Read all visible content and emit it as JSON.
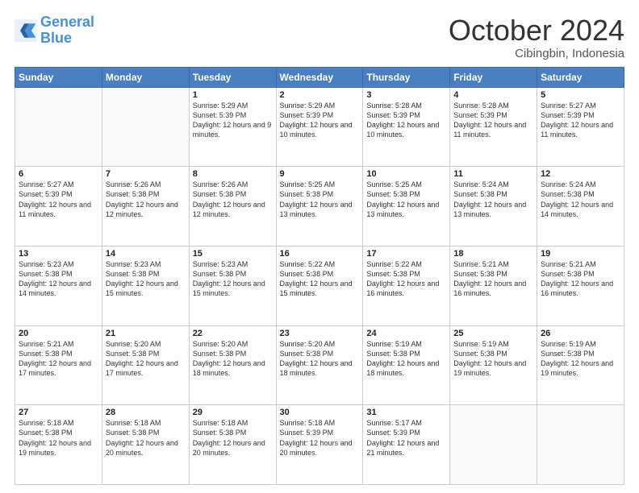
{
  "header": {
    "logo_line1": "General",
    "logo_line2": "Blue",
    "month": "October 2024",
    "location": "Cibingbin, Indonesia"
  },
  "weekdays": [
    "Sunday",
    "Monday",
    "Tuesday",
    "Wednesday",
    "Thursday",
    "Friday",
    "Saturday"
  ],
  "weeks": [
    [
      {
        "day": "",
        "info": ""
      },
      {
        "day": "",
        "info": ""
      },
      {
        "day": "1",
        "info": "Sunrise: 5:29 AM\nSunset: 5:39 PM\nDaylight: 12 hours and 9 minutes."
      },
      {
        "day": "2",
        "info": "Sunrise: 5:29 AM\nSunset: 5:39 PM\nDaylight: 12 hours and 10 minutes."
      },
      {
        "day": "3",
        "info": "Sunrise: 5:28 AM\nSunset: 5:39 PM\nDaylight: 12 hours and 10 minutes."
      },
      {
        "day": "4",
        "info": "Sunrise: 5:28 AM\nSunset: 5:39 PM\nDaylight: 12 hours and 11 minutes."
      },
      {
        "day": "5",
        "info": "Sunrise: 5:27 AM\nSunset: 5:39 PM\nDaylight: 12 hours and 11 minutes."
      }
    ],
    [
      {
        "day": "6",
        "info": "Sunrise: 5:27 AM\nSunset: 5:39 PM\nDaylight: 12 hours and 11 minutes."
      },
      {
        "day": "7",
        "info": "Sunrise: 5:26 AM\nSunset: 5:38 PM\nDaylight: 12 hours and 12 minutes."
      },
      {
        "day": "8",
        "info": "Sunrise: 5:26 AM\nSunset: 5:38 PM\nDaylight: 12 hours and 12 minutes."
      },
      {
        "day": "9",
        "info": "Sunrise: 5:25 AM\nSunset: 5:38 PM\nDaylight: 12 hours and 13 minutes."
      },
      {
        "day": "10",
        "info": "Sunrise: 5:25 AM\nSunset: 5:38 PM\nDaylight: 12 hours and 13 minutes."
      },
      {
        "day": "11",
        "info": "Sunrise: 5:24 AM\nSunset: 5:38 PM\nDaylight: 12 hours and 13 minutes."
      },
      {
        "day": "12",
        "info": "Sunrise: 5:24 AM\nSunset: 5:38 PM\nDaylight: 12 hours and 14 minutes."
      }
    ],
    [
      {
        "day": "13",
        "info": "Sunrise: 5:23 AM\nSunset: 5:38 PM\nDaylight: 12 hours and 14 minutes."
      },
      {
        "day": "14",
        "info": "Sunrise: 5:23 AM\nSunset: 5:38 PM\nDaylight: 12 hours and 15 minutes."
      },
      {
        "day": "15",
        "info": "Sunrise: 5:23 AM\nSunset: 5:38 PM\nDaylight: 12 hours and 15 minutes."
      },
      {
        "day": "16",
        "info": "Sunrise: 5:22 AM\nSunset: 5:38 PM\nDaylight: 12 hours and 15 minutes."
      },
      {
        "day": "17",
        "info": "Sunrise: 5:22 AM\nSunset: 5:38 PM\nDaylight: 12 hours and 16 minutes."
      },
      {
        "day": "18",
        "info": "Sunrise: 5:21 AM\nSunset: 5:38 PM\nDaylight: 12 hours and 16 minutes."
      },
      {
        "day": "19",
        "info": "Sunrise: 5:21 AM\nSunset: 5:38 PM\nDaylight: 12 hours and 16 minutes."
      }
    ],
    [
      {
        "day": "20",
        "info": "Sunrise: 5:21 AM\nSunset: 5:38 PM\nDaylight: 12 hours and 17 minutes."
      },
      {
        "day": "21",
        "info": "Sunrise: 5:20 AM\nSunset: 5:38 PM\nDaylight: 12 hours and 17 minutes."
      },
      {
        "day": "22",
        "info": "Sunrise: 5:20 AM\nSunset: 5:38 PM\nDaylight: 12 hours and 18 minutes."
      },
      {
        "day": "23",
        "info": "Sunrise: 5:20 AM\nSunset: 5:38 PM\nDaylight: 12 hours and 18 minutes."
      },
      {
        "day": "24",
        "info": "Sunrise: 5:19 AM\nSunset: 5:38 PM\nDaylight: 12 hours and 18 minutes."
      },
      {
        "day": "25",
        "info": "Sunrise: 5:19 AM\nSunset: 5:38 PM\nDaylight: 12 hours and 19 minutes."
      },
      {
        "day": "26",
        "info": "Sunrise: 5:19 AM\nSunset: 5:38 PM\nDaylight: 12 hours and 19 minutes."
      }
    ],
    [
      {
        "day": "27",
        "info": "Sunrise: 5:18 AM\nSunset: 5:38 PM\nDaylight: 12 hours and 19 minutes."
      },
      {
        "day": "28",
        "info": "Sunrise: 5:18 AM\nSunset: 5:38 PM\nDaylight: 12 hours and 20 minutes."
      },
      {
        "day": "29",
        "info": "Sunrise: 5:18 AM\nSunset: 5:38 PM\nDaylight: 12 hours and 20 minutes."
      },
      {
        "day": "30",
        "info": "Sunrise: 5:18 AM\nSunset: 5:39 PM\nDaylight: 12 hours and 20 minutes."
      },
      {
        "day": "31",
        "info": "Sunrise: 5:17 AM\nSunset: 5:39 PM\nDaylight: 12 hours and 21 minutes."
      },
      {
        "day": "",
        "info": ""
      },
      {
        "day": "",
        "info": ""
      }
    ]
  ]
}
